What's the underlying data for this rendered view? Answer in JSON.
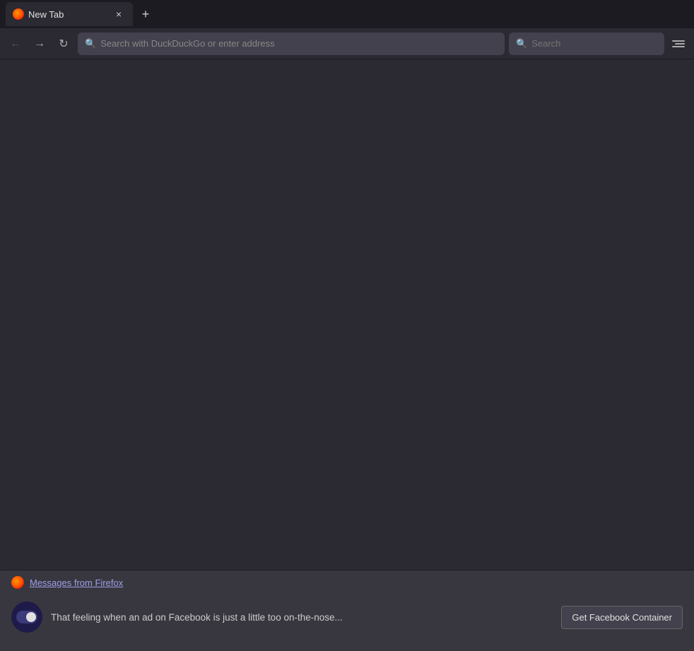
{
  "tab": {
    "label": "New Tab",
    "close_label": "×"
  },
  "new_tab_btn": "+",
  "nav": {
    "back_label": "←",
    "forward_label": "→",
    "reload_label": "↻"
  },
  "address_bar": {
    "placeholder": "Search with DuckDuckGo or enter address"
  },
  "search_box": {
    "placeholder": "Search",
    "label": "Search"
  },
  "notification": {
    "title": "Messages from Firefox",
    "body_text": "That feeling when an ad on Facebook is just a little too on-the-nose...",
    "cta_label": "Get Facebook Container"
  }
}
